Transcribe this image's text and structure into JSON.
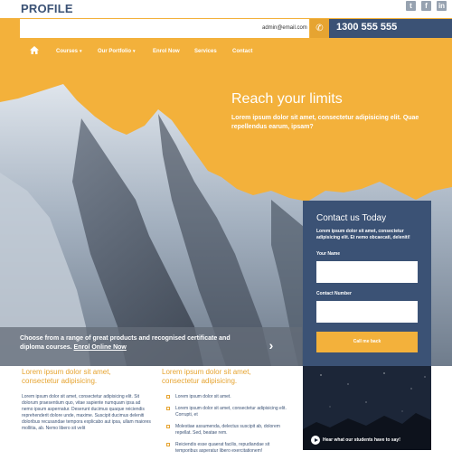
{
  "header": {
    "logo": "PROFILE",
    "social": [
      {
        "icon": "twitter-icon",
        "glyph": "t"
      },
      {
        "icon": "facebook-icon",
        "glyph": "f"
      },
      {
        "icon": "linkedin-icon",
        "glyph": "in"
      }
    ],
    "email": "admin@email.com",
    "phone": "1300 555 555"
  },
  "nav": {
    "items": [
      {
        "label": "Courses",
        "dropdown": true
      },
      {
        "label": "Our Portfolio",
        "dropdown": true
      },
      {
        "label": "Enrol Now",
        "dropdown": false
      },
      {
        "label": "Services",
        "dropdown": false
      },
      {
        "label": "Contact",
        "dropdown": false
      }
    ]
  },
  "hero": {
    "title": "Reach your limits",
    "subtitle": "Lorem ipsum dolor sit amet, consectetur adipisicing elit. Quae repellendus earum, ipsam?"
  },
  "strip": {
    "text": "Choose from a range of great products and recognised certificate and diploma courses.",
    "link": "Enrol Online Now"
  },
  "contact_form": {
    "title": "Contact us Today",
    "description": "Lorem ipsum dolor sit amet, consectetur adipisicing elit. Et nemo obcaecati, deleniti!",
    "name_label": "Your Name",
    "number_label": "Contact Number",
    "button": "Call me back"
  },
  "content": {
    "col1_title": "Lorem ipsum dolor sit amet, consectetur adipisicing.",
    "col1_text": "Lorem ipsum dolor sit amet, consectetur adipisicing elit. Sit dolorum praesentium quo, vitae sapiente numquam ipsa ad nemo ipsum aspernatur. Deserunt ducimus quaque reiciendis reprehenderit dolore unde, maxime. Suscipit ducimus deleniti doloribus recusandae tempora explicabo aut ipsa, ullam maiores mollitia, ab. Nemo libero sit velit",
    "col2_title": "Lorem ipsum dolor sit amet, consectetur adipisicing.",
    "list": [
      "Lorem ipsum dolor sit amet.",
      "Lorem ipsum dolor sit amet, consectetur adipisicing elit. Corrupti, et",
      "Molestiae assumenda, delectus suscipit ab, dolorem repellat. Sed, beatae rem.",
      "Reiciendis esse quaerat facilis, repudiandae sit temporibus asperatur libero exercitationem!"
    ]
  },
  "video": {
    "caption": "Hear what our students have to say!"
  }
}
